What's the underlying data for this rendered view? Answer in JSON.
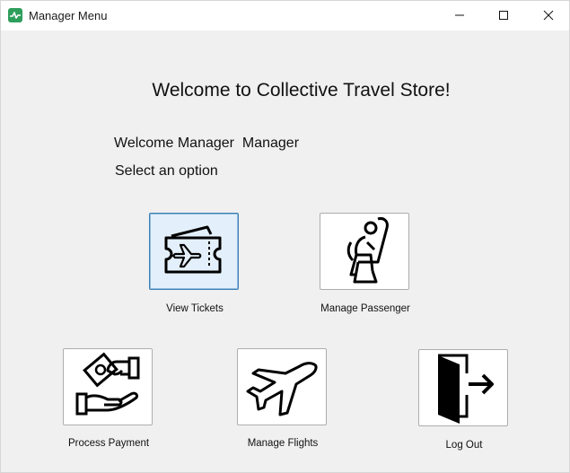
{
  "window": {
    "title": "Manager Menu",
    "controls": {
      "minimize": "minimize-icon",
      "maximize": "maximize-icon",
      "close": "close-icon"
    }
  },
  "main": {
    "heading": "Welcome to Collective Travel Store!",
    "welcome_text": "Welcome Manager  Manager",
    "prompt": "Select an option"
  },
  "options": {
    "view_tickets": {
      "label": "View Tickets",
      "icon": "ticket-plane-icon"
    },
    "manage_passenger": {
      "label": "Manage Passenger",
      "icon": "seated-passenger-icon"
    },
    "process_payment": {
      "label": "Process Payment",
      "icon": "hand-money-icon"
    },
    "manage_flights": {
      "label": "Manage Flights",
      "icon": "airplane-icon"
    },
    "log_out": {
      "label": "Log Out",
      "icon": "exit-door-icon"
    }
  },
  "colors": {
    "app_icon": "#2e9e5b",
    "selected_border": "#3c7fb1",
    "selected_fill": "#e3f0fb"
  }
}
